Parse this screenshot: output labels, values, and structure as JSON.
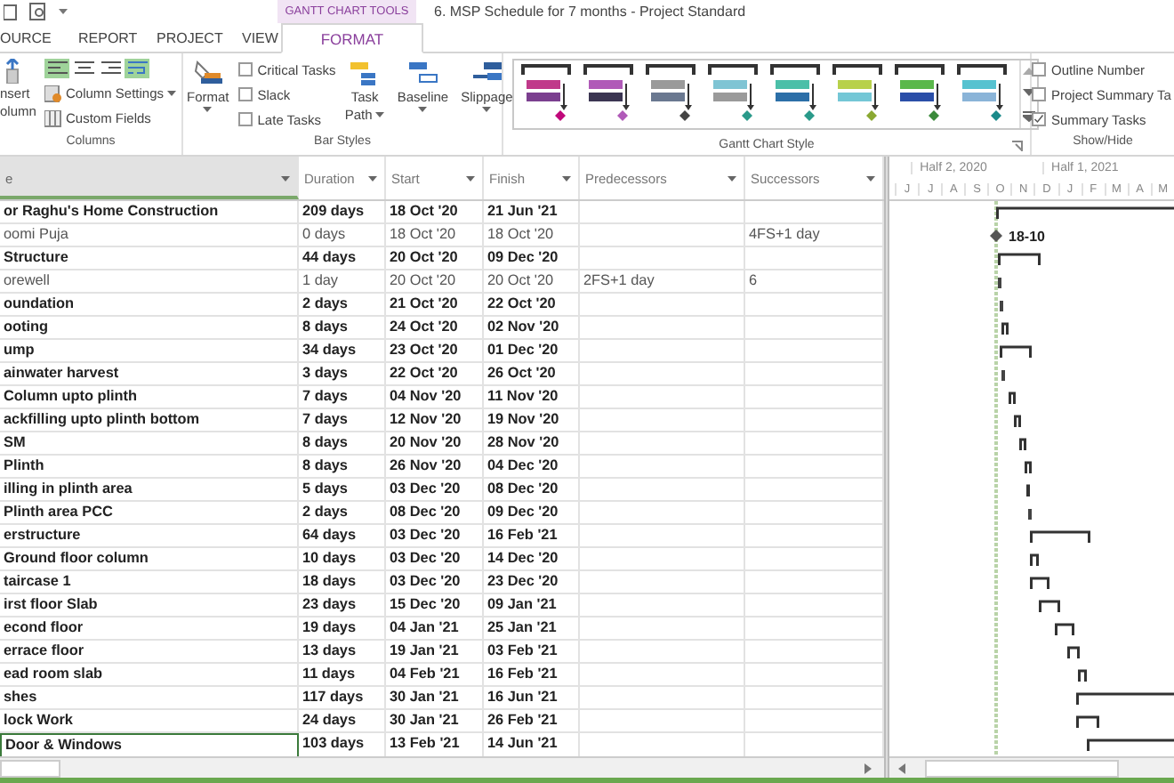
{
  "window": {
    "title": "6. MSP Schedule for 7 months - Project Standard",
    "tool_tab": "GANTT CHART TOOLS"
  },
  "tabs": [
    {
      "label": "OURCE",
      "selected": false
    },
    {
      "label": "REPORT",
      "selected": false
    },
    {
      "label": "PROJECT",
      "selected": false
    },
    {
      "label": "VIEW",
      "selected": false
    },
    {
      "label": "FORMAT",
      "selected": true
    }
  ],
  "ribbon": {
    "columns_group": {
      "label": "Columns",
      "insert_column": [
        "nsert",
        "olumn"
      ],
      "align_buttons": [
        {
          "kind": "left",
          "selected": true
        },
        {
          "kind": "center",
          "selected": false
        },
        {
          "kind": "right",
          "selected": false
        },
        {
          "kind": "wrap",
          "selected": true
        }
      ],
      "column_settings": "Column Settings",
      "custom_fields": "Custom Fields"
    },
    "bar_styles": {
      "label": "Bar Styles",
      "format": "Format",
      "checkboxes": [
        {
          "label": "Critical Tasks",
          "checked": false
        },
        {
          "label": "Slack",
          "checked": false
        },
        {
          "label": "Late Tasks",
          "checked": false
        }
      ],
      "task_path": [
        "Task",
        "Path"
      ],
      "baseline": "Baseline",
      "slippage": "Slippage"
    },
    "gantt_style": {
      "label": "Gantt Chart Style"
    },
    "show_hide": {
      "label": "Show/Hide",
      "checkboxes": [
        {
          "label": "Outline Number",
          "checked": false
        },
        {
          "label": "Project Summary Ta",
          "checked": false
        },
        {
          "label": "Summary Tasks",
          "checked": true
        }
      ]
    }
  },
  "table": {
    "columns": [
      {
        "label": "e",
        "selected": true
      },
      {
        "label": "Duration",
        "selected": false
      },
      {
        "label": "Start",
        "selected": false
      },
      {
        "label": "Finish",
        "selected": false
      },
      {
        "label": "Predecessors",
        "selected": false
      },
      {
        "label": "Successors",
        "selected": false
      }
    ],
    "rows": [
      {
        "name": "or Raghu's Home Construction",
        "duration": "209 days",
        "start": "18 Oct '20",
        "finish": "21 Jun '21",
        "predecessors": "",
        "successors": "",
        "summary": true,
        "selected": false
      },
      {
        "name": "oomi Puja",
        "duration": "0 days",
        "start": "18 Oct '20",
        "finish": "18 Oct '20",
        "predecessors": "",
        "successors": "4FS+1 day",
        "summary": false,
        "selected": false
      },
      {
        "name": "Structure",
        "duration": "44 days",
        "start": "20 Oct '20",
        "finish": "09 Dec '20",
        "predecessors": "",
        "successors": "",
        "summary": true,
        "selected": false
      },
      {
        "name": "orewell",
        "duration": "1 day",
        "start": "20 Oct '20",
        "finish": "20 Oct '20",
        "predecessors": "2FS+1 day",
        "successors": "6",
        "summary": false,
        "selected": false
      },
      {
        "name": "oundation",
        "duration": "2 days",
        "start": "21 Oct '20",
        "finish": "22 Oct '20",
        "predecessors": "",
        "successors": "",
        "summary": true,
        "selected": false
      },
      {
        "name": "ooting",
        "duration": "8 days",
        "start": "24 Oct '20",
        "finish": "02 Nov '20",
        "predecessors": "",
        "successors": "",
        "summary": true,
        "selected": false
      },
      {
        "name": "ump",
        "duration": "34 days",
        "start": "23 Oct '20",
        "finish": "01 Dec '20",
        "predecessors": "",
        "successors": "",
        "summary": true,
        "selected": false
      },
      {
        "name": "ainwater harvest",
        "duration": "3 days",
        "start": "22 Oct '20",
        "finish": "26 Oct '20",
        "predecessors": "",
        "successors": "",
        "summary": true,
        "selected": false
      },
      {
        "name": "Column upto plinth",
        "duration": "7 days",
        "start": "04 Nov '20",
        "finish": "11 Nov '20",
        "predecessors": "",
        "successors": "",
        "summary": true,
        "selected": false
      },
      {
        "name": "ackfilling upto plinth bottom",
        "duration": "7 days",
        "start": "12 Nov '20",
        "finish": "19 Nov '20",
        "predecessors": "",
        "successors": "",
        "summary": true,
        "selected": false
      },
      {
        "name": "SM",
        "duration": "8 days",
        "start": "20 Nov '20",
        "finish": "28 Nov '20",
        "predecessors": "",
        "successors": "",
        "summary": true,
        "selected": false
      },
      {
        "name": "Plinth",
        "duration": "8 days",
        "start": "26 Nov '20",
        "finish": "04 Dec '20",
        "predecessors": "",
        "successors": "",
        "summary": true,
        "selected": false
      },
      {
        "name": "illing in plinth area",
        "duration": "5 days",
        "start": "03 Dec '20",
        "finish": "08 Dec '20",
        "predecessors": "",
        "successors": "",
        "summary": true,
        "selected": false
      },
      {
        "name": "Plinth area PCC",
        "duration": "2 days",
        "start": "08 Dec '20",
        "finish": "09 Dec '20",
        "predecessors": "",
        "successors": "",
        "summary": true,
        "selected": false
      },
      {
        "name": "erstructure",
        "duration": "64 days",
        "start": "03 Dec '20",
        "finish": "16 Feb '21",
        "predecessors": "",
        "successors": "",
        "summary": true,
        "selected": false
      },
      {
        "name": "Ground floor column",
        "duration": "10 days",
        "start": "03 Dec '20",
        "finish": "14 Dec '20",
        "predecessors": "",
        "successors": "",
        "summary": true,
        "selected": false
      },
      {
        "name": "taircase 1",
        "duration": "18 days",
        "start": "03 Dec '20",
        "finish": "23 Dec '20",
        "predecessors": "",
        "successors": "",
        "summary": true,
        "selected": false
      },
      {
        "name": "irst floor Slab",
        "duration": "23 days",
        "start": "15 Dec '20",
        "finish": "09 Jan '21",
        "predecessors": "",
        "successors": "",
        "summary": true,
        "selected": false
      },
      {
        "name": "econd floor",
        "duration": "19 days",
        "start": "04 Jan '21",
        "finish": "25 Jan '21",
        "predecessors": "",
        "successors": "",
        "summary": true,
        "selected": false
      },
      {
        "name": "errace floor",
        "duration": "13 days",
        "start": "19 Jan '21",
        "finish": "03 Feb '21",
        "predecessors": "",
        "successors": "",
        "summary": true,
        "selected": false
      },
      {
        "name": "ead room slab",
        "duration": "11 days",
        "start": "04 Feb '21",
        "finish": "16 Feb '21",
        "predecessors": "",
        "successors": "",
        "summary": true,
        "selected": false
      },
      {
        "name": "shes",
        "duration": "117 days",
        "start": "30 Jan '21",
        "finish": "16 Jun '21",
        "predecessors": "",
        "successors": "",
        "summary": true,
        "selected": false
      },
      {
        "name": "lock Work",
        "duration": "24 days",
        "start": "30 Jan '21",
        "finish": "26 Feb '21",
        "predecessors": "",
        "successors": "",
        "summary": true,
        "selected": false
      },
      {
        "name": "Door & Windows",
        "duration": "103 days",
        "start": "13 Feb '21",
        "finish": "14 Jun '21",
        "predecessors": "",
        "successors": "",
        "summary": true,
        "selected": true
      }
    ]
  },
  "gantt": {
    "halves": [
      "Half 2, 2020",
      "Half 1, 2021"
    ],
    "months": [
      "J",
      "J",
      "A",
      "S",
      "O",
      "N",
      "D",
      "J",
      "F",
      "M",
      "A",
      "M"
    ],
    "milestone_label": "18-10"
  }
}
